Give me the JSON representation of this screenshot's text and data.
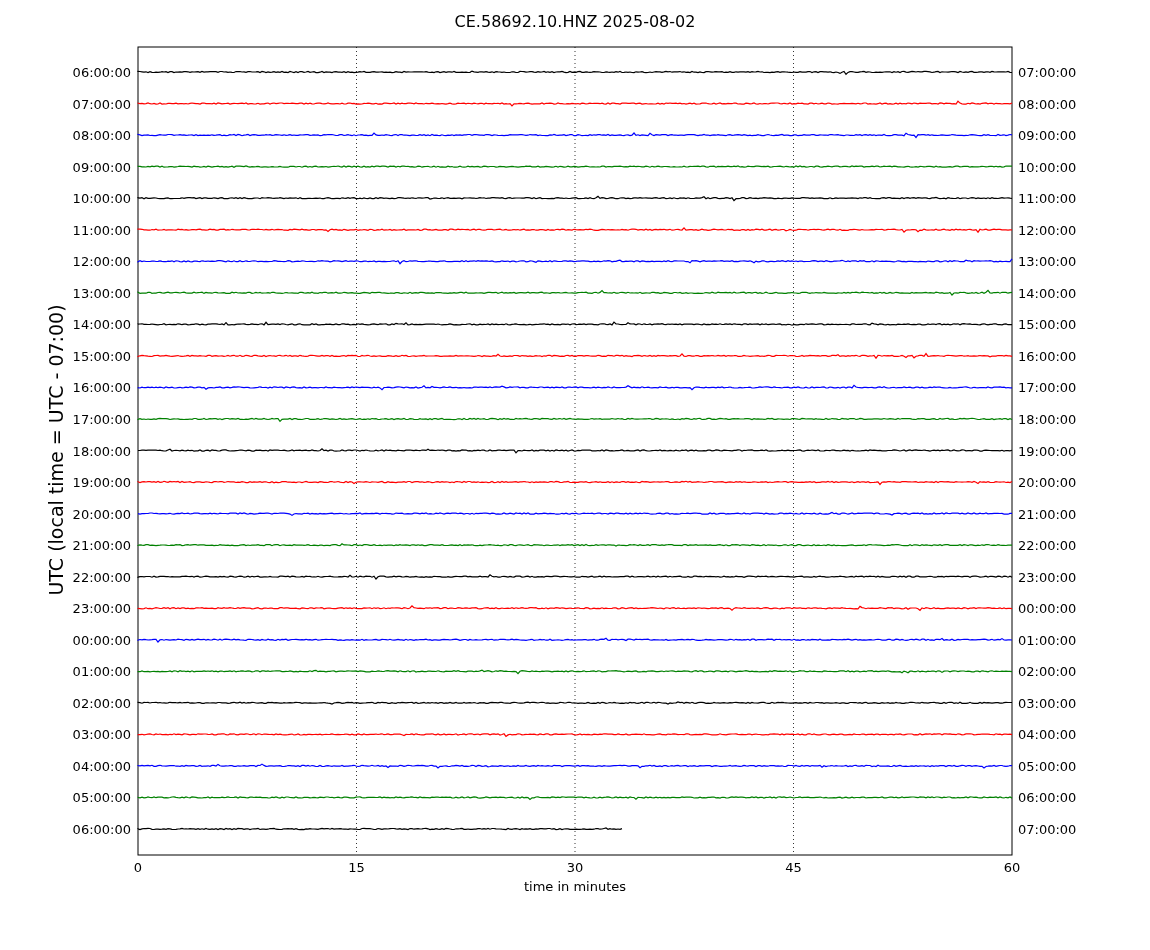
{
  "title": "CE.58692.10.HNZ 2025-08-02",
  "ylabel": "UTC (local time = UTC - 07:00)",
  "xlabel": "time in minutes",
  "xticks": [
    "0",
    "15",
    "30",
    "45",
    "60"
  ],
  "traces": [
    {
      "utc": "06:00:00",
      "local": "07:00:00",
      "color": "#000000",
      "level": 1
    },
    {
      "utc": "07:00:00",
      "local": "08:00:00",
      "color": "#ff0000",
      "level": 1
    },
    {
      "utc": "08:00:00",
      "local": "09:00:00",
      "color": "#0000ff",
      "level": 1
    },
    {
      "utc": "09:00:00",
      "local": "10:00:00",
      "color": "#008000",
      "level": 1
    },
    {
      "utc": "10:00:00",
      "local": "11:00:00",
      "color": "#000000",
      "level": 1
    },
    {
      "utc": "11:00:00",
      "local": "12:00:00",
      "color": "#ff0000",
      "level": 1
    },
    {
      "utc": "12:00:00",
      "local": "13:00:00",
      "color": "#0000ff",
      "level": 1
    },
    {
      "utc": "13:00:00",
      "local": "14:00:00",
      "color": "#008000",
      "level": 1
    },
    {
      "utc": "14:00:00",
      "local": "15:00:00",
      "color": "#000000",
      "level": 1
    },
    {
      "utc": "15:00:00",
      "local": "16:00:00",
      "color": "#ff0000",
      "level": 1
    },
    {
      "utc": "16:00:00",
      "local": "17:00:00",
      "color": "#0000ff",
      "level": 1
    },
    {
      "utc": "17:00:00",
      "local": "18:00:00",
      "color": "#008000",
      "level": 1
    },
    {
      "utc": "18:00:00",
      "local": "19:00:00",
      "color": "#000000",
      "level": 1
    },
    {
      "utc": "19:00:00",
      "local": "20:00:00",
      "color": "#ff0000",
      "level": 1
    },
    {
      "utc": "20:00:00",
      "local": "21:00:00",
      "color": "#0000ff",
      "level": 1
    },
    {
      "utc": "21:00:00",
      "local": "22:00:00",
      "color": "#008000",
      "level": 1
    },
    {
      "utc": "22:00:00",
      "local": "23:00:00",
      "color": "#000000",
      "level": 1
    },
    {
      "utc": "23:00:00",
      "local": "00:00:00",
      "color": "#ff0000",
      "level": 1
    },
    {
      "utc": "00:00:00",
      "local": "01:00:00",
      "color": "#0000ff",
      "level": 1
    },
    {
      "utc": "01:00:00",
      "local": "02:00:00",
      "color": "#008000",
      "level": 1
    },
    {
      "utc": "02:00:00",
      "local": "03:00:00",
      "color": "#000000",
      "level": 1
    },
    {
      "utc": "03:00:00",
      "local": "04:00:00",
      "color": "#ff0000",
      "level": 1
    },
    {
      "utc": "04:00:00",
      "local": "05:00:00",
      "color": "#0000ff",
      "level": 1
    },
    {
      "utc": "05:00:00",
      "local": "06:00:00",
      "color": "#008000",
      "level": 1
    },
    {
      "utc": "06:00:00",
      "local": "07:00:00",
      "color": "#000000",
      "level": 0.555
    }
  ]
}
